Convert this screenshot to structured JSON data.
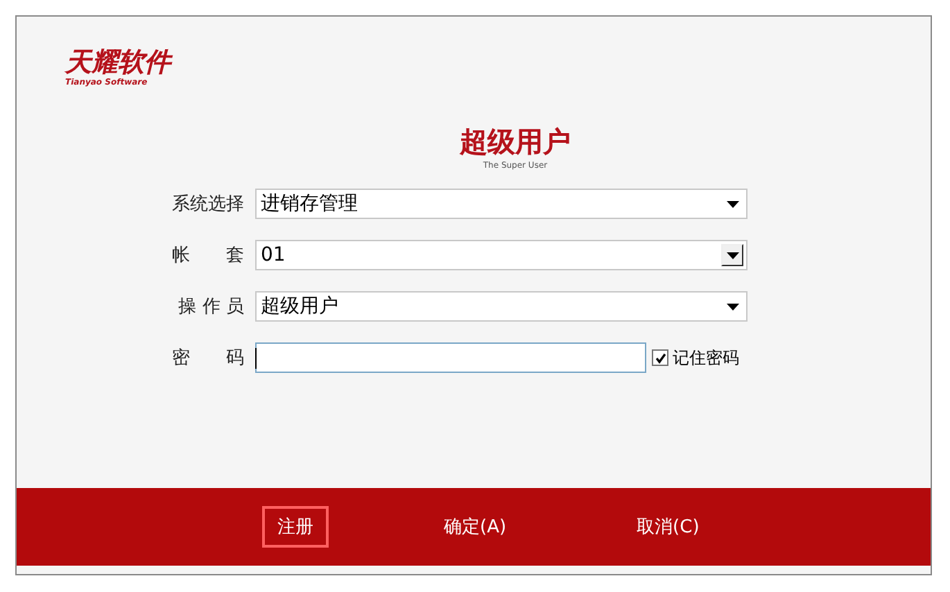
{
  "logo": {
    "name": "天耀软件",
    "subtitle": "Tianyao Software"
  },
  "heading": {
    "title": "超级用户",
    "subtitle": "The Super User"
  },
  "fields": [
    {
      "label": "系统选择",
      "kind": "combo",
      "value": "进销存管理"
    },
    {
      "label": "帐　　套",
      "kind": "combo-button",
      "value": "01"
    },
    {
      "label": "操 作 员",
      "kind": "combo",
      "value": "超级用户"
    },
    {
      "label": "密　　码",
      "kind": "password",
      "focused": true
    }
  ],
  "remember": {
    "label": "记住密码",
    "checked": true
  },
  "buttons": [
    {
      "label": "注册",
      "focused": true
    },
    {
      "label": "确定(A)",
      "focused": false
    },
    {
      "label": "取消(C)",
      "focused": false
    }
  ]
}
